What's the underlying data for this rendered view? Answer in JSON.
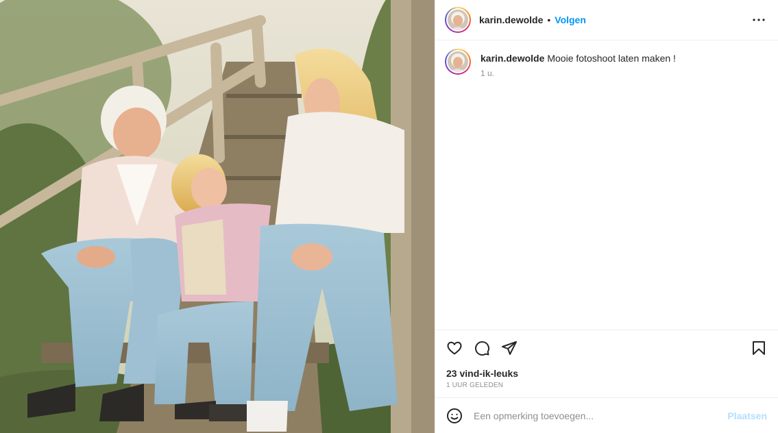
{
  "post": {
    "image_alt": "Family photo on wooden stairs",
    "author": {
      "username": "karin.dewolde",
      "separator": "•",
      "follow_label": "Volgen"
    },
    "caption": {
      "username": "karin.dewolde",
      "text": "Mooie fotoshoot laten maken !",
      "time": "1 u."
    },
    "likes_text": "23 vind-ik-leuks",
    "posted_ago": "1 UUR GELEDEN",
    "comment": {
      "placeholder": "Een opmerking toevoegen...",
      "submit_label": "Plaatsen"
    },
    "icons": {
      "more": "more-horizontal-icon",
      "like": "heart-icon",
      "comment": "comment-icon",
      "share": "share-icon",
      "save": "bookmark-icon",
      "emoji": "emoji-icon"
    },
    "colors": {
      "accent": "#0095f6",
      "disabled_accent": "#b2dffc",
      "muted": "#8e8e8e"
    }
  }
}
